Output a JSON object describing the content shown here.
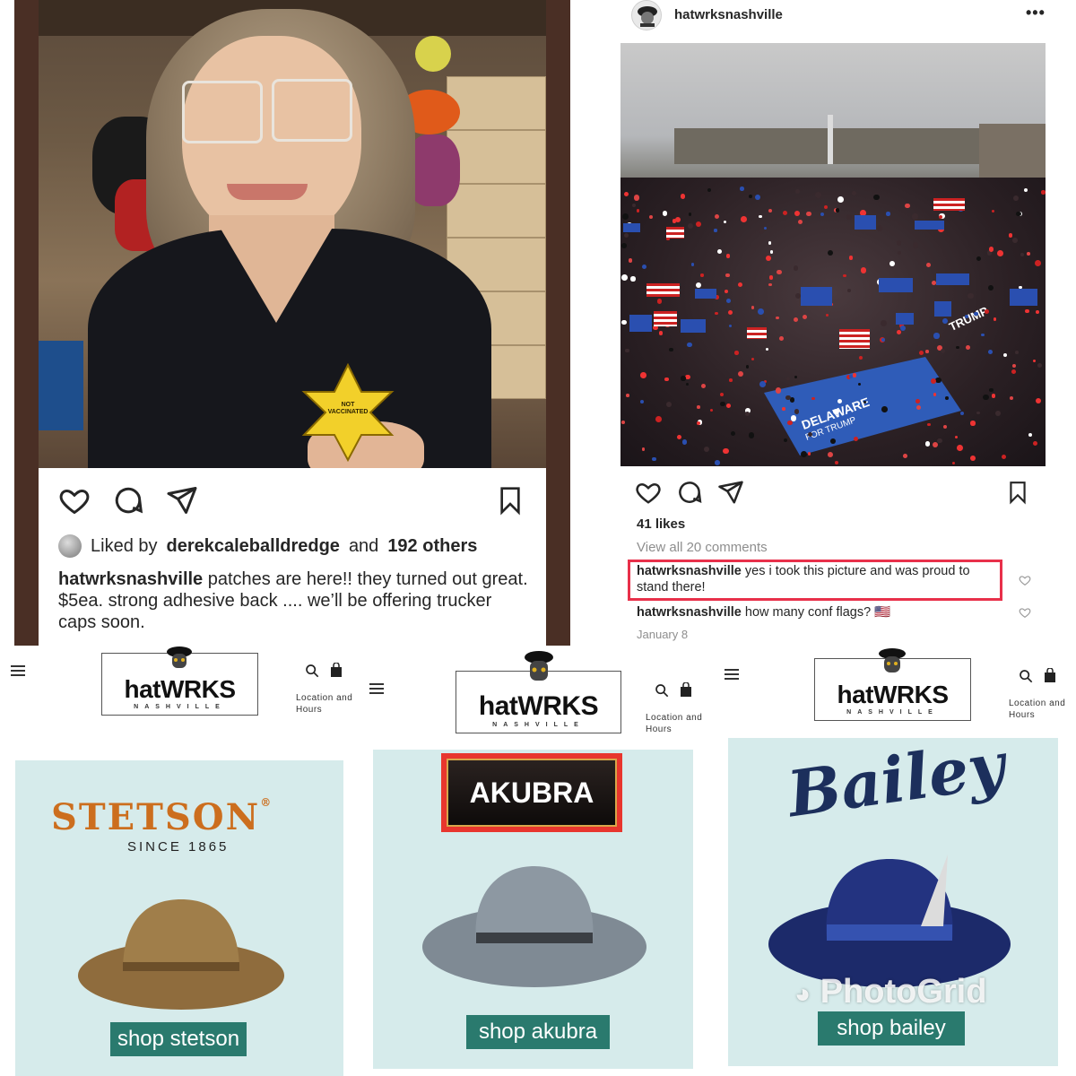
{
  "post1": {
    "liked_prefix": "Liked by",
    "liked_user": "derekcaleballdredge",
    "liked_mid": "and",
    "liked_others": "192 others",
    "caption_user": "hatwrksnashville",
    "caption_text": "patches are here!! they turned out great. $5ea. strong adhesive back .... we’ll be offering trucker caps soon.",
    "patch_line1": "NOT",
    "patch_line2": "VACCINATED",
    "icons": [
      "heart-icon",
      "comment-icon",
      "share-icon",
      "bookmark-icon"
    ]
  },
  "post2": {
    "username": "hatwrksnashville",
    "more": "•••",
    "likes": "41 likes",
    "view_all": "View all 20 comments",
    "comments": [
      {
        "user": "hatwrksnashville",
        "text": "yes i took this picture and was proud to stand there!"
      },
      {
        "user": "hatwrksnashville",
        "text": "how many conf flags? 🇺🇸"
      }
    ],
    "date": "January 8",
    "photo_texts": [
      "DELAWARE",
      "FOR TRUMP",
      "TRUMP"
    ],
    "icons": [
      "heart-icon",
      "comment-icon",
      "share-icon",
      "bookmark-icon"
    ]
  },
  "site": {
    "logo": "hatWRKS",
    "logo_sub": "NASHVILLE",
    "location": "Location and Hours",
    "location_line1": "Location and",
    "location_line2": "Hours"
  },
  "cards": {
    "stetson": {
      "brand": "STETSON",
      "reg": "®",
      "since": "SINCE 1865",
      "button": "shop stetson"
    },
    "akubra": {
      "brand": "AKUBRA",
      "button": "shop akubra"
    },
    "bailey": {
      "brand": "Bailey",
      "reg": "®",
      "button": "shop bailey"
    }
  },
  "watermark": "PhotoGrid",
  "colors": {
    "accent_highlight": "#e8304a",
    "button_teal": "#2a7a6e",
    "card_bg": "#d6ebeb",
    "stetson_orange": "#cc6e1e",
    "bailey_navy": "#1c2f5c",
    "akubra_red": "#e8362e"
  }
}
